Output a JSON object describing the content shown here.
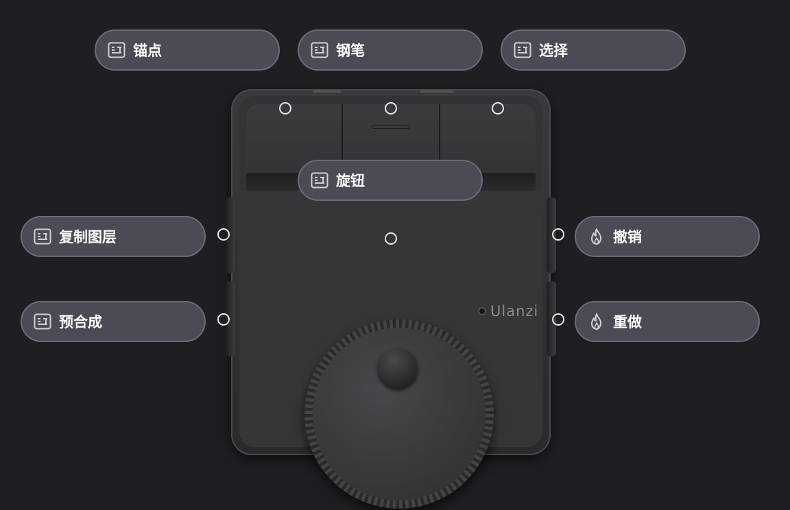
{
  "device": {
    "brand": "Ulanzi"
  },
  "labels": {
    "key1": "锚点",
    "key2": "钢笔",
    "key3": "选择",
    "dial": "旋钮",
    "left_top": "复制图层",
    "left_bottom": "预合成",
    "right_top": "撤销",
    "right_bottom": "重做"
  },
  "icons": {
    "action": "layout-panel-icon",
    "history": "flame-icon"
  },
  "colors": {
    "background": "#1f1f23",
    "pill": "#4b4b55",
    "pill_border": "#6b6b75",
    "text": "#ffffff"
  }
}
